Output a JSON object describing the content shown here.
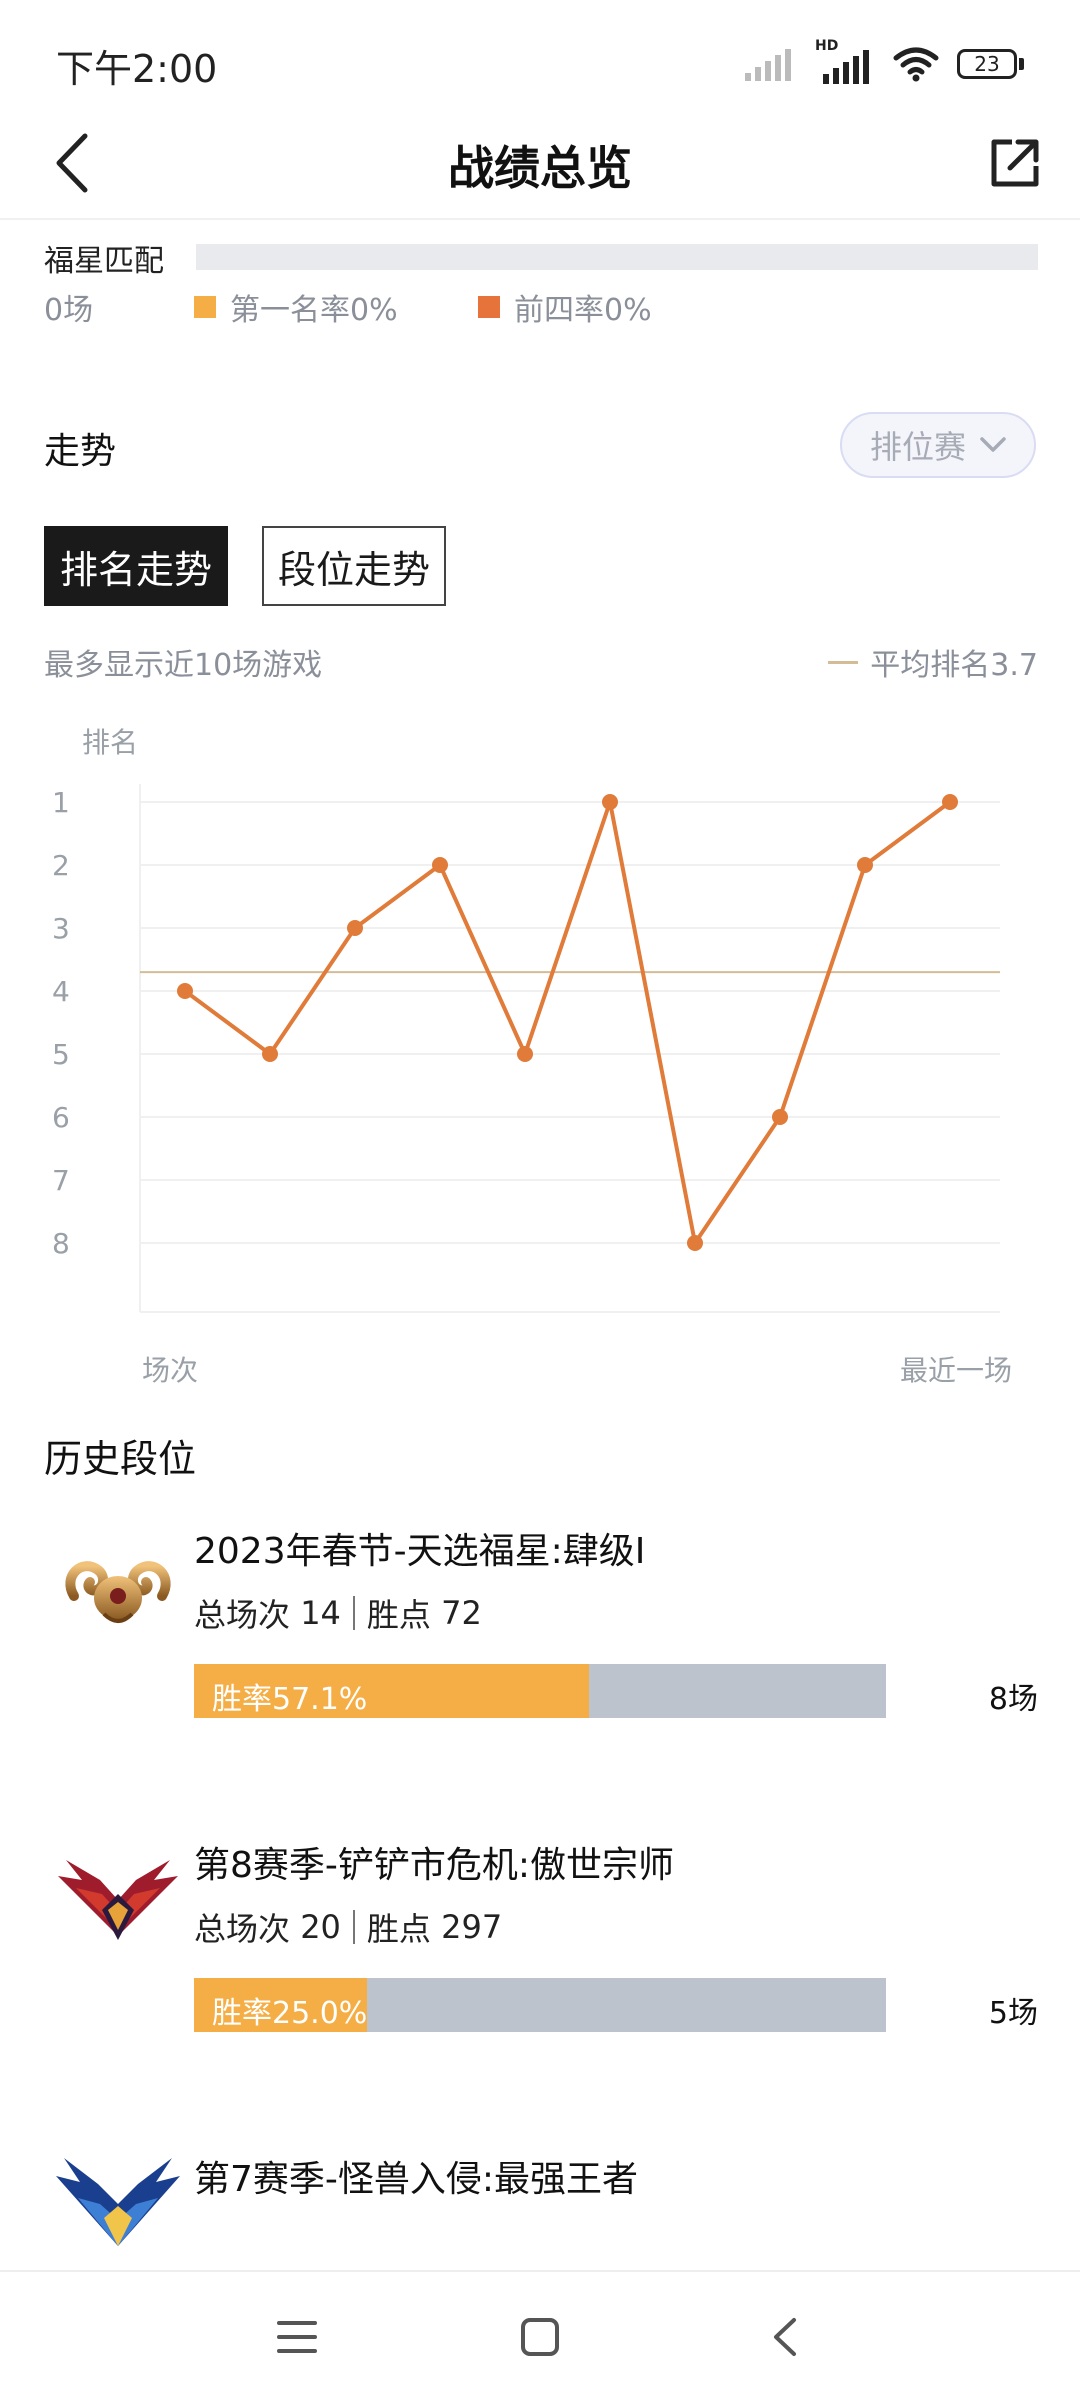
{
  "status": {
    "time": "下午2:00",
    "battery": "23",
    "network": "HD"
  },
  "header": {
    "title": "战绩总览"
  },
  "lucky": {
    "label": "福星匹配",
    "count": "0场",
    "first_rate_label": "第一名率0%",
    "top4_rate_label": "前四率0%",
    "colors": {
      "first": "#f5ae45",
      "top4": "#e6733a"
    }
  },
  "trend": {
    "title": "走势",
    "mode": "排位赛",
    "tabs": [
      "排名走势",
      "段位走势"
    ],
    "hint": "最多显示近10场游戏",
    "avg_label": "平均排名3.7"
  },
  "chart_data": {
    "type": "line",
    "ylabel": "排名",
    "xlabel_start": "场次",
    "xlabel_end": "最近一场",
    "y_ticks": [
      1,
      2,
      3,
      4,
      5,
      6,
      7,
      8
    ],
    "ylim": [
      1,
      8
    ],
    "y_inverted": true,
    "series": [
      {
        "values": [
          4,
          5,
          3,
          2,
          5,
          1,
          8,
          6,
          2,
          1
        ]
      }
    ],
    "average": 3.7,
    "colors": {
      "line": "#e07b39",
      "average": "#d4bd96",
      "grid": "#f0f0f0"
    }
  },
  "history": {
    "title": "历史段位",
    "seasons": [
      {
        "name": "2023年春节-天选福星:肆级I",
        "total_label": "总场次",
        "total": "14",
        "points_label": "胜点",
        "points": "72",
        "win_rate_label": "胜率57.1%",
        "win_rate": 0.571,
        "games": "8场",
        "icon": "ram-emblem-icon"
      },
      {
        "name": "第8赛季-铲铲市危机:傲世宗师",
        "total_label": "总场次",
        "total": "20",
        "points_label": "胜点",
        "points": "297",
        "win_rate_label": "胜率25.0%",
        "win_rate": 0.25,
        "games": "5场",
        "icon": "grandmaster-emblem-icon"
      },
      {
        "name": "第7赛季-怪兽入侵:最强王者",
        "icon": "challenger-emblem-icon"
      }
    ]
  }
}
